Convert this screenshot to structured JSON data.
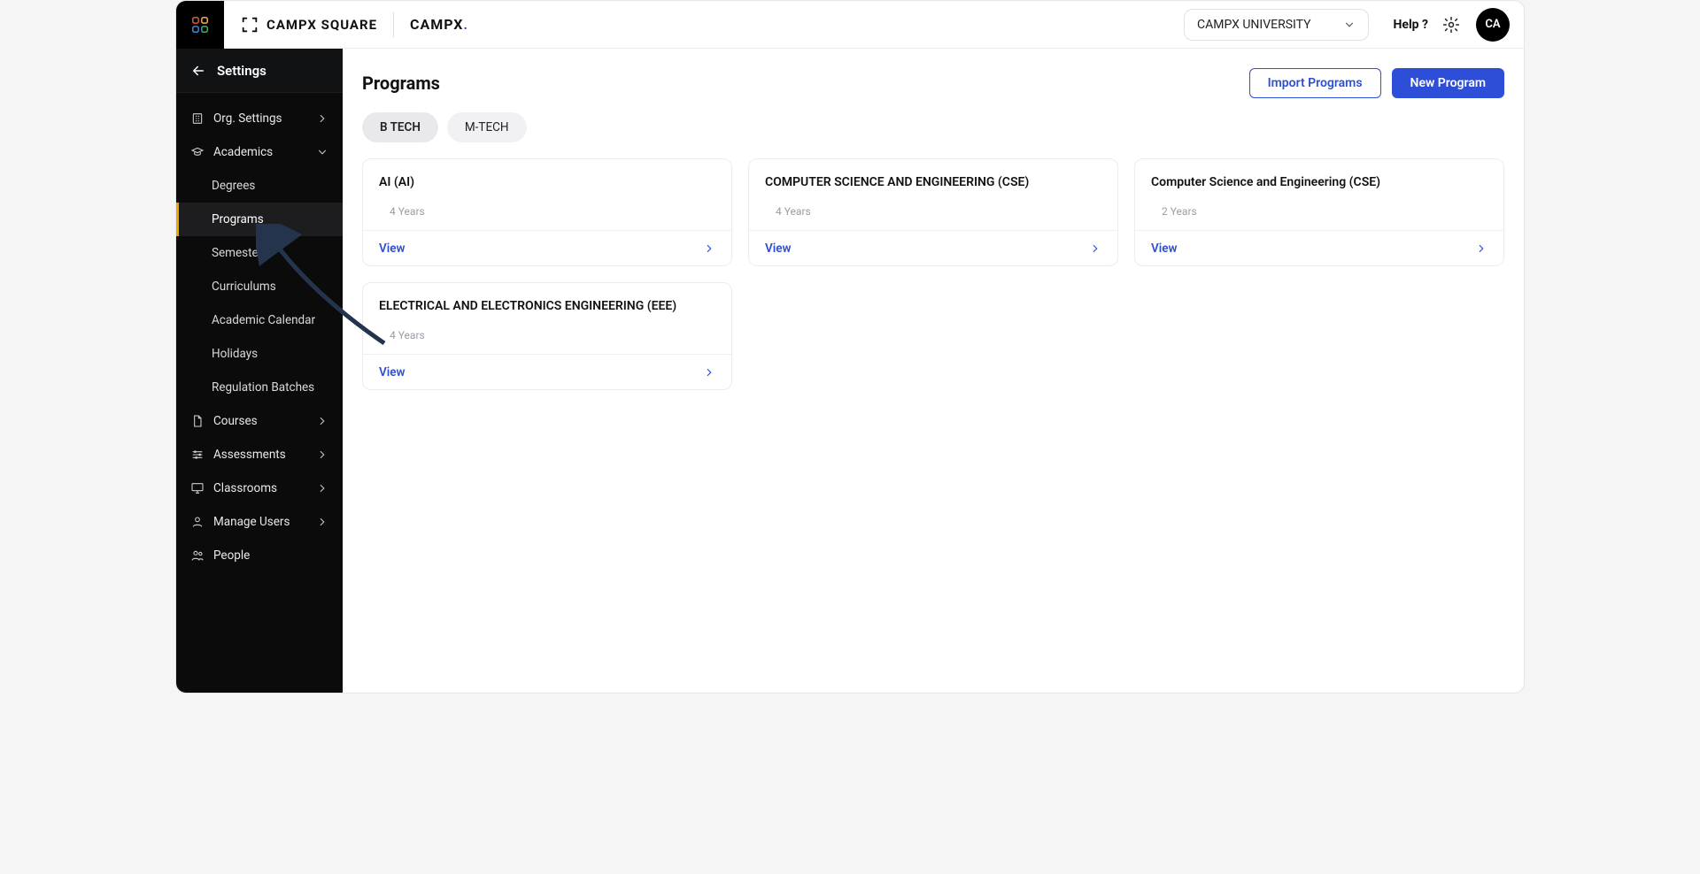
{
  "header": {
    "brand_left": "CAMPX SQUARE",
    "brand_right": "CAMPX",
    "org_selected": "CAMPX UNIVERSITY",
    "help": "Help ?",
    "avatar_initials": "CA"
  },
  "sidebar": {
    "back_title": "Settings",
    "items": [
      {
        "label": "Org. Settings",
        "icon": "building-icon",
        "expandable": true,
        "expanded": false
      },
      {
        "label": "Academics",
        "icon": "graduation-icon",
        "expandable": true,
        "expanded": true,
        "children": [
          {
            "label": "Degrees",
            "active": false
          },
          {
            "label": "Programs",
            "active": true
          },
          {
            "label": "Semesters",
            "active": false
          },
          {
            "label": "Curriculums",
            "active": false
          },
          {
            "label": "Academic Calendar",
            "active": false
          },
          {
            "label": "Holidays",
            "active": false
          },
          {
            "label": "Regulation Batches",
            "active": false
          }
        ]
      },
      {
        "label": "Courses",
        "icon": "document-icon",
        "expandable": true,
        "expanded": false
      },
      {
        "label": "Assessments",
        "icon": "sliders-icon",
        "expandable": true,
        "expanded": false
      },
      {
        "label": "Classrooms",
        "icon": "monitor-icon",
        "expandable": true,
        "expanded": false
      },
      {
        "label": "Manage Users",
        "icon": "user-icon",
        "expandable": true,
        "expanded": false
      },
      {
        "label": "People",
        "icon": "people-icon",
        "expandable": false,
        "expanded": false
      }
    ]
  },
  "page": {
    "title": "Programs",
    "actions": {
      "import": "Import Programs",
      "new": "New Program"
    },
    "tabs": [
      {
        "label": "B TECH",
        "active": true
      },
      {
        "label": "M-TECH",
        "active": false
      }
    ],
    "cards": [
      {
        "title": "AI (AI)",
        "duration": "4 Years",
        "view": "View"
      },
      {
        "title": "COMPUTER SCIENCE AND ENGINEERING (CSE)",
        "duration": "4 Years",
        "view": "View"
      },
      {
        "title": "Computer Science and Engineering (CSE)",
        "duration": "2 Years",
        "view": "View"
      },
      {
        "title": "ELECTRICAL AND ELECTRONICS ENGINEERING (EEE)",
        "duration": "4 Years",
        "view": "View"
      }
    ]
  }
}
